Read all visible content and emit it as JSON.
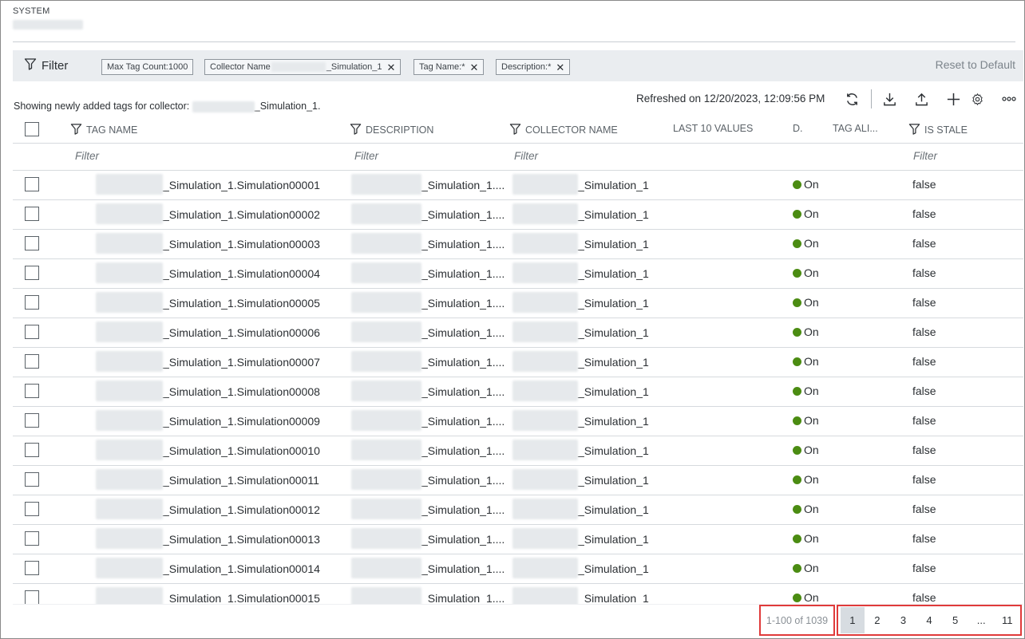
{
  "header": {
    "section_label": "SYSTEM"
  },
  "filter_bar": {
    "title": "Filter",
    "chips": [
      {
        "label": "Max Tag Count:1000",
        "removable": false
      },
      {
        "label": "Collector Name",
        "suffix": "_Simulation_1",
        "removable": true
      },
      {
        "label": "Tag Name:*",
        "removable": true
      },
      {
        "label": "Description:*",
        "removable": true
      }
    ],
    "reset_label": "Reset to Default"
  },
  "info": {
    "showing_prefix": "Showing newly added tags for collector: ",
    "showing_suffix": "_Simulation_1.",
    "refreshed": "Refreshed on 12/20/2023, 12:09:56 PM"
  },
  "toolbar": {
    "icons": [
      "refresh-icon",
      "download-icon",
      "upload-icon",
      "add-icon",
      "settings-icon",
      "more-icon"
    ]
  },
  "table": {
    "columns": {
      "tag_name": "TAG NAME",
      "description": "DESCRIPTION",
      "collector_name": "COLLECTOR NAME",
      "last_values": "LAST 10 VALUES",
      "d": "D.",
      "tag_alias": "TAG ALI...",
      "is_stale": "IS STALE"
    },
    "filter_placeholder": "Filter",
    "status_color": "#4b8c12",
    "rows": [
      {
        "tag": "_Simulation_1.Simulation00001",
        "desc": "_Simulation_1....",
        "collector": "_Simulation_1",
        "status": "On",
        "stale": "false"
      },
      {
        "tag": "_Simulation_1.Simulation00002",
        "desc": "_Simulation_1....",
        "collector": "_Simulation_1",
        "status": "On",
        "stale": "false"
      },
      {
        "tag": "_Simulation_1.Simulation00003",
        "desc": "_Simulation_1....",
        "collector": "_Simulation_1",
        "status": "On",
        "stale": "false"
      },
      {
        "tag": "_Simulation_1.Simulation00004",
        "desc": "_Simulation_1....",
        "collector": "_Simulation_1",
        "status": "On",
        "stale": "false"
      },
      {
        "tag": "_Simulation_1.Simulation00005",
        "desc": "_Simulation_1....",
        "collector": "_Simulation_1",
        "status": "On",
        "stale": "false"
      },
      {
        "tag": "_Simulation_1.Simulation00006",
        "desc": "_Simulation_1....",
        "collector": "_Simulation_1",
        "status": "On",
        "stale": "false"
      },
      {
        "tag": "_Simulation_1.Simulation00007",
        "desc": "_Simulation_1....",
        "collector": "_Simulation_1",
        "status": "On",
        "stale": "false"
      },
      {
        "tag": "_Simulation_1.Simulation00008",
        "desc": "_Simulation_1....",
        "collector": "_Simulation_1",
        "status": "On",
        "stale": "false"
      },
      {
        "tag": "_Simulation_1.Simulation00009",
        "desc": "_Simulation_1....",
        "collector": "_Simulation_1",
        "status": "On",
        "stale": "false"
      },
      {
        "tag": "_Simulation_1.Simulation00010",
        "desc": "_Simulation_1....",
        "collector": "_Simulation_1",
        "status": "On",
        "stale": "false"
      },
      {
        "tag": "_Simulation_1.Simulation00011",
        "desc": "_Simulation_1....",
        "collector": "_Simulation_1",
        "status": "On",
        "stale": "false"
      },
      {
        "tag": "_Simulation_1.Simulation00012",
        "desc": "_Simulation_1....",
        "collector": "_Simulation_1",
        "status": "On",
        "stale": "false"
      },
      {
        "tag": "_Simulation_1.Simulation00013",
        "desc": "_Simulation_1....",
        "collector": "_Simulation_1",
        "status": "On",
        "stale": "false"
      },
      {
        "tag": "_Simulation_1.Simulation00014",
        "desc": "_Simulation_1....",
        "collector": "_Simulation_1",
        "status": "On",
        "stale": "false"
      },
      {
        "tag": "_Simulation_1.Simulation00015",
        "desc": "_Simulation_1....",
        "collector": "_Simulation_1",
        "status": "On",
        "stale": "false"
      }
    ]
  },
  "pagination": {
    "range": "1-100 of 1039",
    "pages": [
      "1",
      "2",
      "3",
      "4",
      "5",
      "...",
      "11"
    ],
    "current": "1"
  }
}
